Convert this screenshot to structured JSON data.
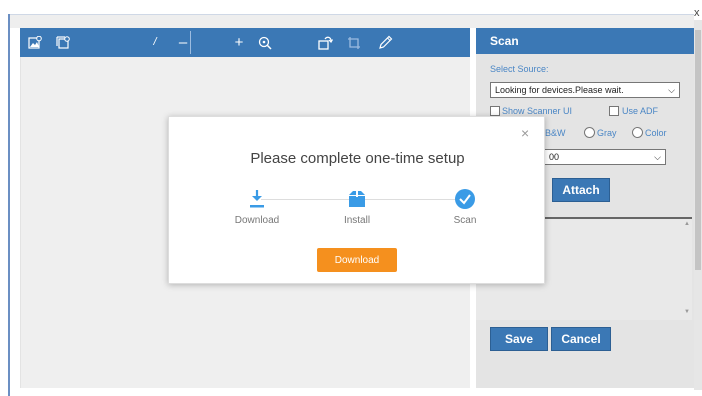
{
  "window": {
    "close_glyph": "x"
  },
  "toolbar": {
    "icons": [
      "add-image-icon",
      "copy-image-icon",
      "rotate-icon",
      "crop-icon",
      "edit-pencil-icon",
      "zoom-icon"
    ],
    "divider_text": "/",
    "zoom_out": "–",
    "zoom_in": "+"
  },
  "panel": {
    "title": "Scan",
    "source_label": "Select Source:",
    "source_value": "Looking for devices.Please wait.",
    "show_scanner_ui": "Show Scanner UI",
    "use_adf": "Use ADF",
    "color_bw": "B&W",
    "color_gray": "Gray",
    "color_color": "Color",
    "dpi_value": "00",
    "attach_label": "Attach",
    "save_label": "Save",
    "cancel_label": "Cancel"
  },
  "modal": {
    "title": "Please complete one-time setup",
    "close_glyph": "×",
    "steps": [
      {
        "label": "Download",
        "icon": "download-icon"
      },
      {
        "label": "Install",
        "icon": "package-icon"
      },
      {
        "label": "Scan",
        "icon": "check-circle-icon"
      }
    ],
    "button_label": "Download"
  },
  "colors": {
    "accent": "#3b78b5",
    "download": "#f5901e",
    "step_active": "#3a9be6"
  }
}
